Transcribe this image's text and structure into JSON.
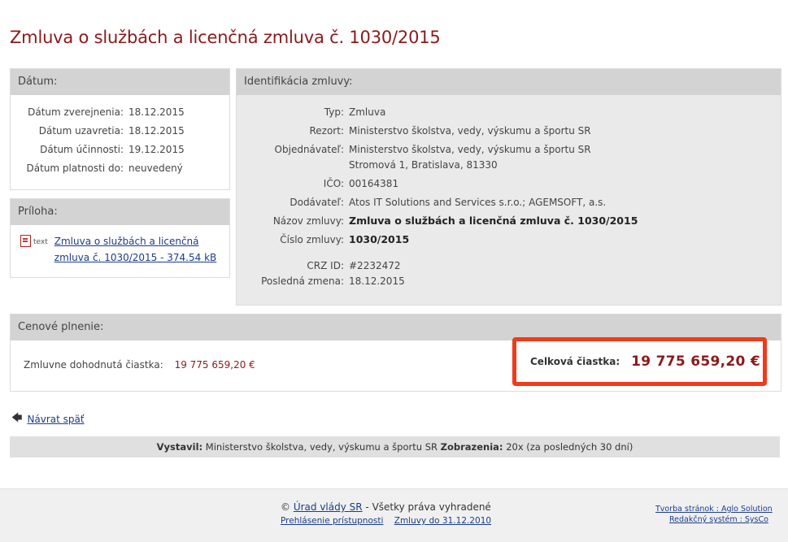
{
  "title": "Zmluva o službách a licenčná zmluva č. 1030/2015",
  "datum": {
    "header": "Dátum:",
    "rows": [
      {
        "label": "Dátum zverejnenia:",
        "value": "18.12.2015"
      },
      {
        "label": "Dátum uzavretia:",
        "value": "18.12.2015"
      },
      {
        "label": "Dátum účinnosti:",
        "value": "19.12.2015"
      },
      {
        "label": "Dátum platnosti do:",
        "value": "neuvedený"
      }
    ]
  },
  "priloha": {
    "header": "Príloha:",
    "icon": "pdf-icon",
    "type_tag": "text",
    "link_text": "Zmluva o službách a licenčná zmluva č. 1030/2015 - 374.54 kB"
  },
  "identifikacia": {
    "header": "Identifikácia zmluvy:",
    "typ_label": "Typ:",
    "typ": "Zmluva",
    "rezort_label": "Rezort:",
    "rezort": "Ministerstvo školstva, vedy, výskumu a športu SR",
    "objednavatel_label": "Objednávateľ:",
    "objednavatel_1": "Ministerstvo školstva, vedy, výskumu a športu SR",
    "objednavatel_2": "Stromová 1, Bratislava, 81330",
    "ico_label": "IČO:",
    "ico": "00164381",
    "dodavatel_label": "Dodávateľ:",
    "dodavatel": "Atos IT Solutions and Services s.r.o.; AGEMSOFT, a.s.",
    "nazov_label": "Názov zmluvy:",
    "nazov": "Zmluva o službách a licenčná zmluva č. 1030/2015",
    "cislo_label": "Číslo zmluvy:",
    "cislo": "1030/2015",
    "crz_label": "CRZ ID:",
    "crz": "#2232472",
    "zmena_label": "Posledná zmena:",
    "zmena": "18.12.2015"
  },
  "cena": {
    "header": "Cenové plnenie:",
    "agreed_label": "Zmluvne dohodnutá čiastka:",
    "agreed_value": "19 775 659,20 €",
    "total_label": "Celková čiastka:",
    "total_value": "19 775 659,20 €",
    "highlight_color": "#f03a1a"
  },
  "back": {
    "arrow": "🡄",
    "label": "Návrat späť"
  },
  "info": {
    "vystavil_label": "Vystavil:",
    "vystavil": "Ministerstvo školstva, vedy, výskumu a športu SR",
    "zobrazenia_label": "Zobrazenia:",
    "zobrazenia": "20x (za posledných 30 dní)"
  },
  "footer": {
    "copyright": "©",
    "urad_link": "Úrad vlády SR",
    "rights": " - Všetky práva vyhradené",
    "pristupnost": "Prehlásenie prístupnosti",
    "zmluvy": "Zmluvy do 31.12.2010",
    "tvorba": "Tvorba stránok : Aglo Solution",
    "redakcny": "Redakčný systém : SysCo"
  },
  "colors": {
    "title": "#8b1a1a",
    "link": "#1a3c8c",
    "header_bg": "#d3d3d3"
  }
}
